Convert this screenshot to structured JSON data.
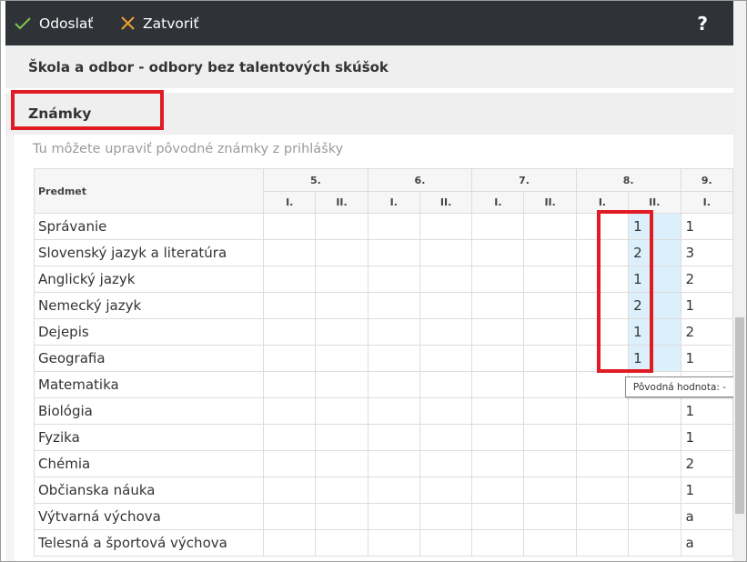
{
  "toolbar": {
    "send_label": "Odoslať",
    "close_label": "Zatvoriť",
    "help_label": "?",
    "send_icon": "check-icon",
    "close_icon": "x-icon",
    "send_color": "#7cc04b",
    "close_color": "#f0a030"
  },
  "section1_title": "Škola a odbor - odbory bez talentových skúšok",
  "section2_title": "Známky",
  "hint": "Tu môžete upraviť pôvodné známky z prihlášky",
  "table": {
    "subject_header": "Predmet",
    "years": [
      "5.",
      "6.",
      "7.",
      "8.",
      "9."
    ],
    "halves": [
      "I.",
      "II.",
      "I.",
      "II.",
      "I.",
      "II.",
      "I.",
      "II.",
      "I."
    ],
    "rows": [
      {
        "subject": "Správanie",
        "g8_2": "1",
        "g9_1": "1"
      },
      {
        "subject": "Slovenský jazyk a literatúra",
        "g8_2": "2",
        "g9_1": "3"
      },
      {
        "subject": "Anglický jazyk",
        "g8_2": "1",
        "g9_1": "2"
      },
      {
        "subject": "Nemecký jazyk",
        "g8_2": "2",
        "g9_1": "1"
      },
      {
        "subject": "Dejepis",
        "g8_2": "1",
        "g9_1": "2"
      },
      {
        "subject": "Geografia",
        "g8_2": "1",
        "g9_1": "1"
      },
      {
        "subject": "Matematika",
        "g8_2": "",
        "g9_1": ""
      },
      {
        "subject": "Biológia",
        "g8_2": "",
        "g9_1": "1"
      },
      {
        "subject": "Fyzika",
        "g8_2": "",
        "g9_1": "1"
      },
      {
        "subject": "Chémia",
        "g8_2": "",
        "g9_1": "2"
      },
      {
        "subject": "Občianska náuka",
        "g8_2": "",
        "g9_1": "1"
      },
      {
        "subject": "Výtvarná výchova",
        "g8_2": "",
        "g9_1": "a"
      },
      {
        "subject": "Telesná a športová výchova",
        "g8_2": "",
        "g9_1": "a"
      }
    ]
  },
  "tooltip": "Pôvodná hodnota: -",
  "accent_red": "#e01b24",
  "edit_cell_color": "#dcf0fc"
}
